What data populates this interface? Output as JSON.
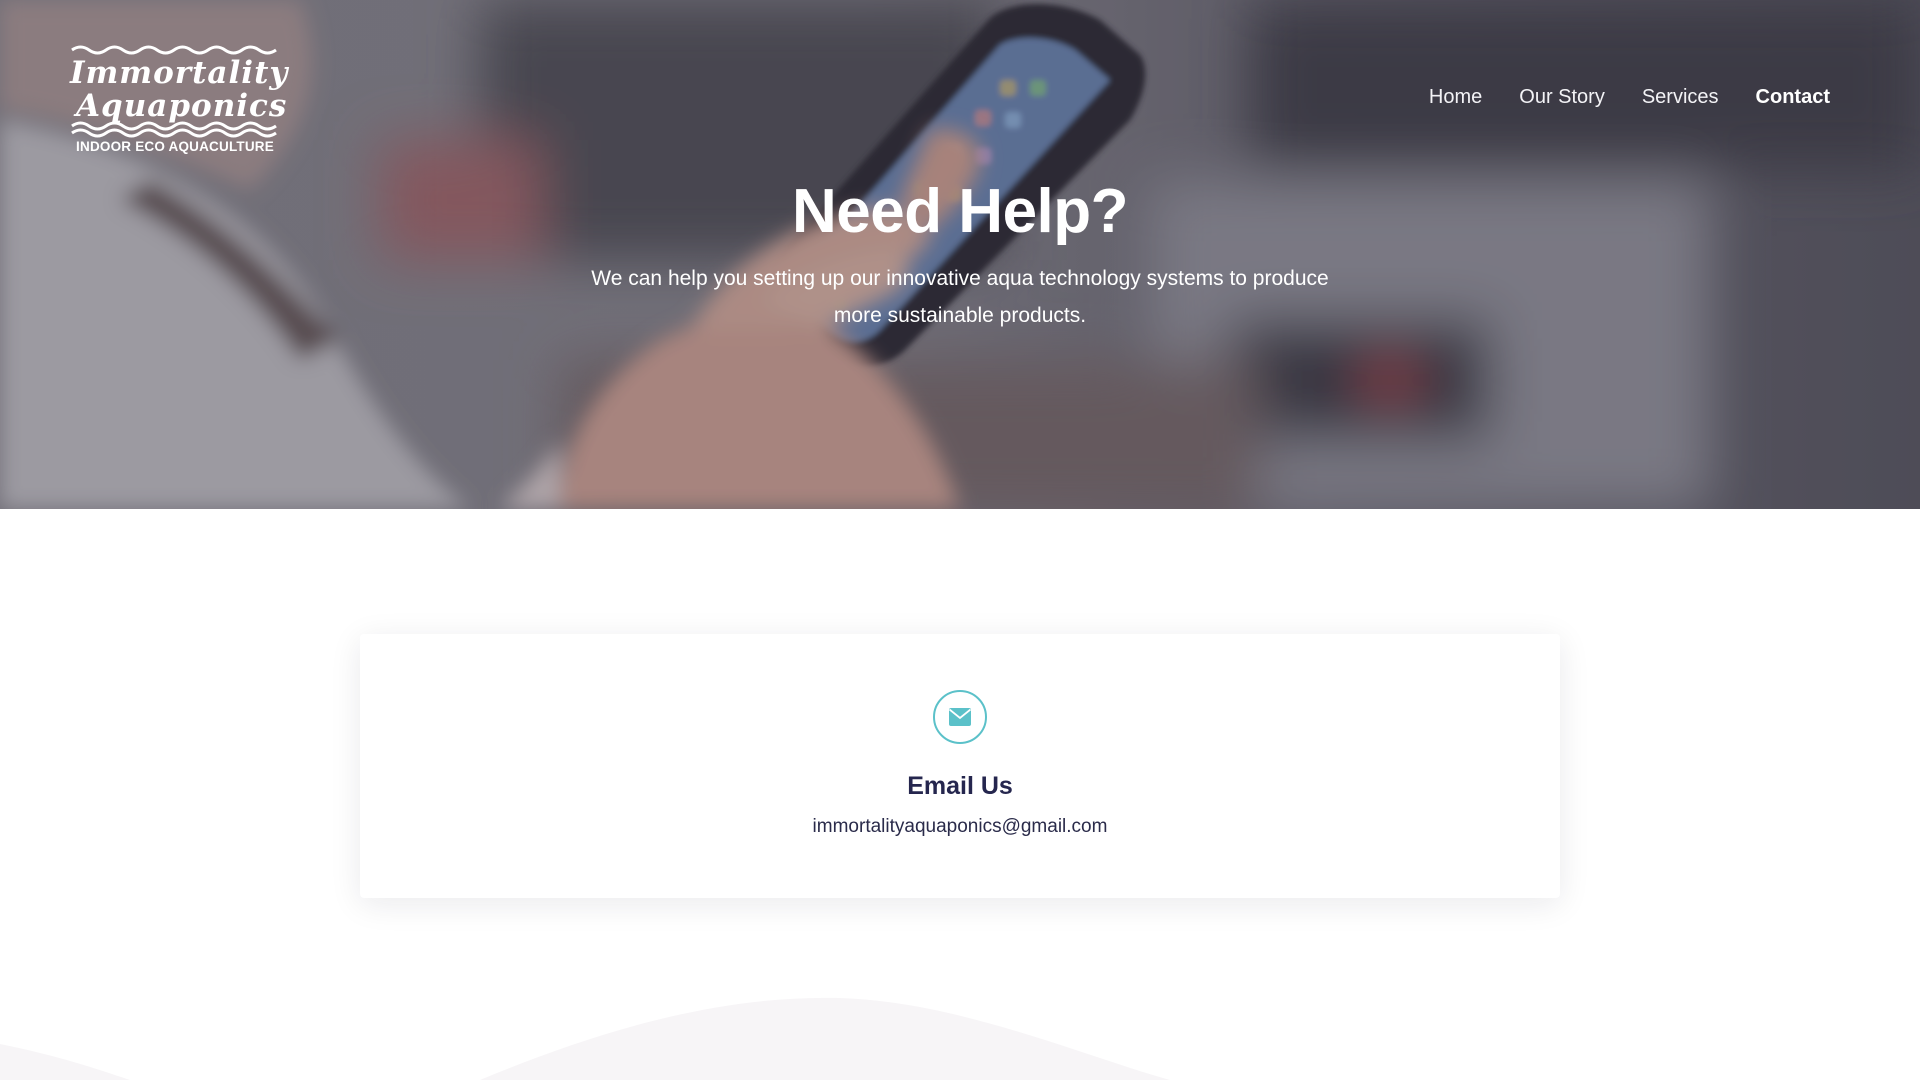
{
  "brand": {
    "logo_line1": "Immortality",
    "logo_line2": "Aquaponics",
    "tagline": "INDOOR ECO AQUACULTURE"
  },
  "nav": {
    "items": [
      {
        "label": "Home",
        "active": false
      },
      {
        "label": "Our Story",
        "active": false
      },
      {
        "label": "Services",
        "active": false
      },
      {
        "label": "Contact",
        "active": true
      }
    ]
  },
  "hero": {
    "title": "Need Help?",
    "subtitle": "We can help you setting up our innovative aqua technology systems to produce more sustainable products."
  },
  "contact_card": {
    "icon": "envelope-icon",
    "title": "Email Us",
    "email": "immortalityaquaponics@gmail.com"
  },
  "colors": {
    "accent": "#5bc1c9",
    "heading": "#25264e",
    "body_text": "#2a2b4a"
  }
}
